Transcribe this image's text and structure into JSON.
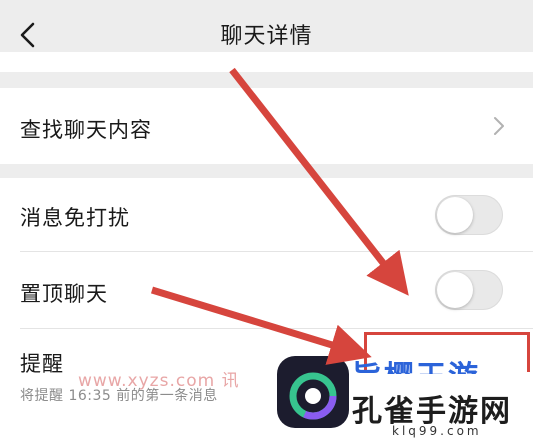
{
  "nav": {
    "title": "聊天详情"
  },
  "cells": {
    "search_chat": {
      "label": "查找聊天内容"
    },
    "mute": {
      "label": "消息免打扰",
      "on": false
    },
    "sticky": {
      "label": "置顶聊天",
      "on": false
    },
    "reminder": {
      "label": "提醒",
      "subtitle": "将提醒 16:35 前的第一条消息"
    }
  },
  "watermark": {
    "url": "www.xyzs.com 讯",
    "logo_top": "旨樱王游",
    "logo_text": "孔雀手游网",
    "logo_domain": "klq99.com"
  },
  "colors": {
    "arrow": "#d6453d",
    "background": "#ededed",
    "cell": "#ffffff"
  }
}
